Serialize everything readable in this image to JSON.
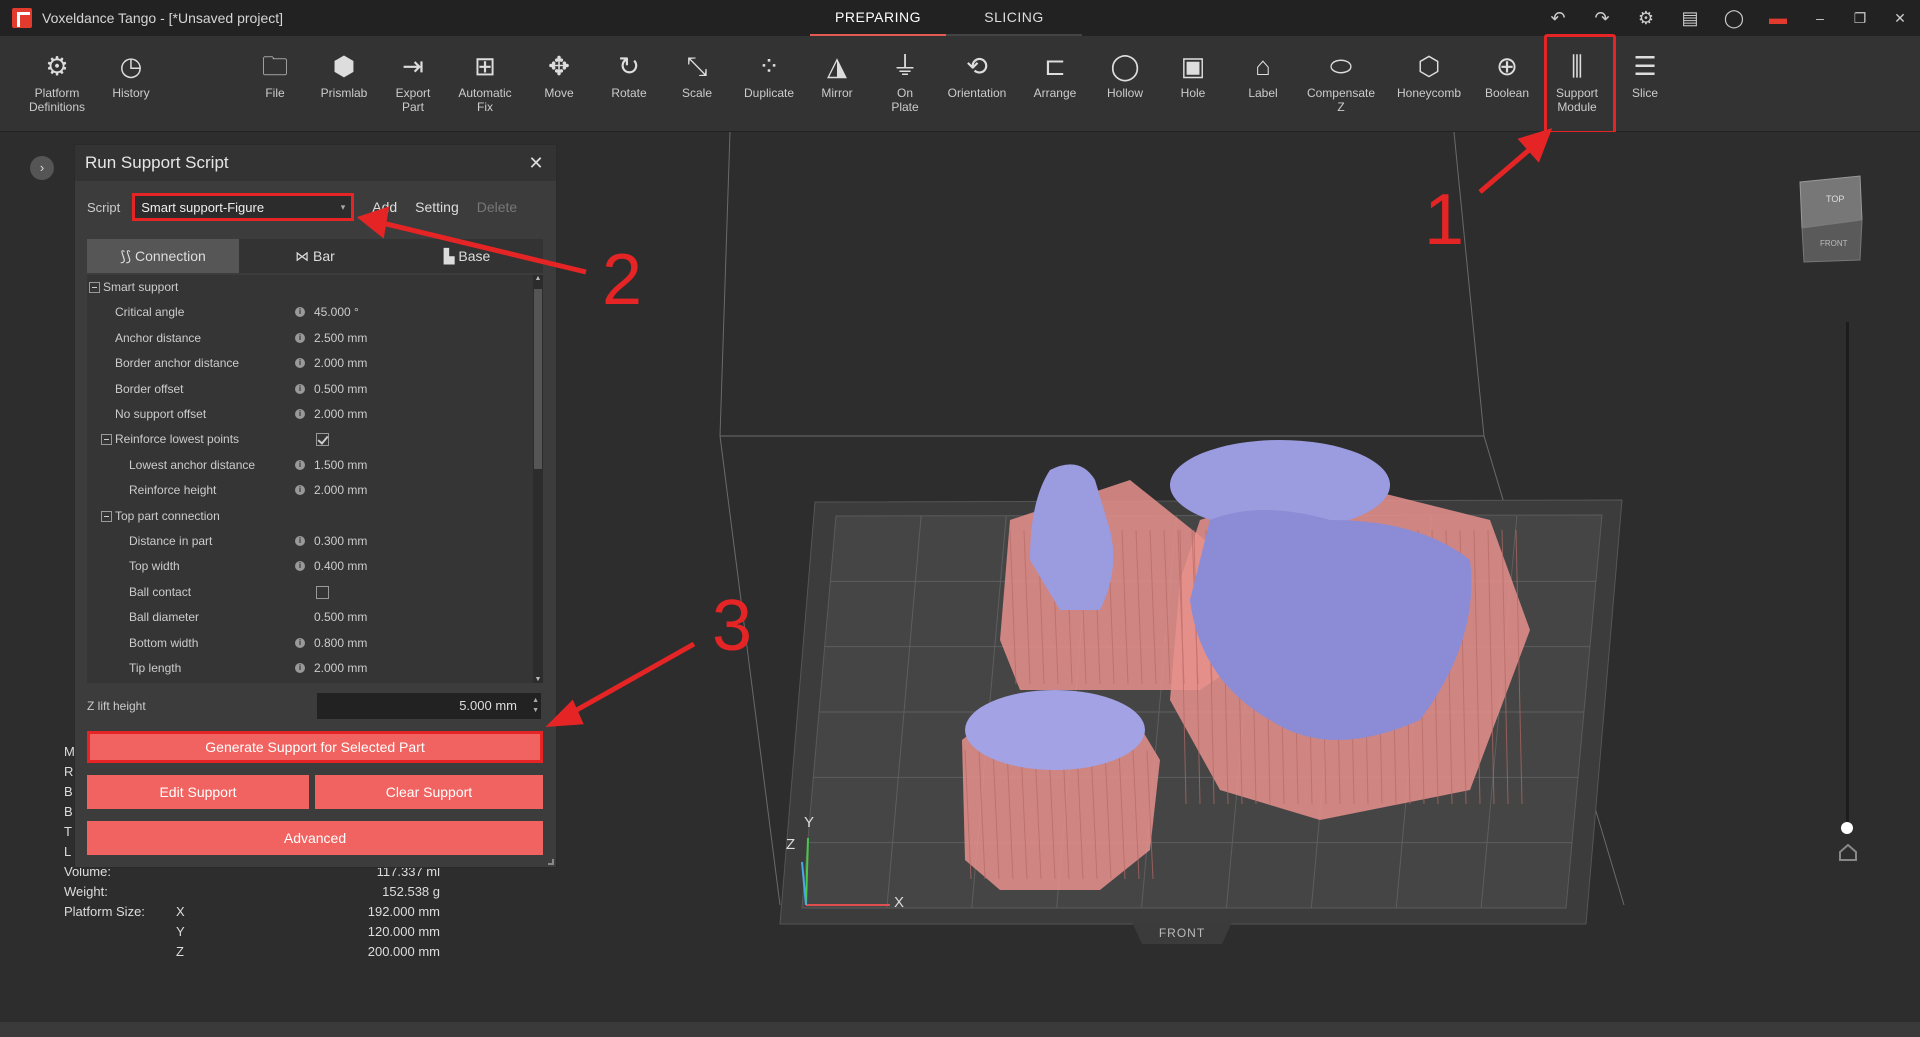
{
  "app": {
    "title": "Voxeldance Tango - [*Unsaved project]"
  },
  "mode_tabs": [
    {
      "label": "PREPARING",
      "active": true
    },
    {
      "label": "SLICING",
      "active": false
    }
  ],
  "title_icons": [
    "undo-icon",
    "redo-icon",
    "settings-icon",
    "feedback-icon",
    "account-icon",
    "license-icon",
    "minimize-icon",
    "restore-icon",
    "close-icon"
  ],
  "toolbar": {
    "tools": [
      {
        "label": "Platform\nDefinitions",
        "icon": "platform-definitions-icon"
      },
      {
        "label": "History",
        "icon": "history-icon"
      },
      {
        "label": "File",
        "icon": "file-icon"
      },
      {
        "label": "Prismlab",
        "icon": "prismlab-icon"
      },
      {
        "label": "Export\nPart",
        "icon": "export-part-icon"
      },
      {
        "label": "Automatic\nFix",
        "icon": "automatic-fix-icon"
      },
      {
        "label": "Move",
        "icon": "move-icon"
      },
      {
        "label": "Rotate",
        "icon": "rotate-icon"
      },
      {
        "label": "Scale",
        "icon": "scale-icon"
      },
      {
        "label": "Duplicate",
        "icon": "duplicate-icon"
      },
      {
        "label": "Mirror",
        "icon": "mirror-icon"
      },
      {
        "label": "On\nPlate",
        "icon": "on-plate-icon"
      },
      {
        "label": "Orientation",
        "icon": "orientation-icon"
      },
      {
        "label": "Arrange",
        "icon": "arrange-icon"
      },
      {
        "label": "Hollow",
        "icon": "hollow-icon"
      },
      {
        "label": "Hole",
        "icon": "hole-icon"
      },
      {
        "label": "Label",
        "icon": "label-icon"
      },
      {
        "label": "Compensate\nZ",
        "icon": "compensate-z-icon"
      },
      {
        "label": "Honeycomb",
        "icon": "honeycomb-icon"
      },
      {
        "label": "Boolean",
        "icon": "boolean-icon"
      },
      {
        "label": "Support\nModule",
        "icon": "support-module-icon"
      },
      {
        "label": "Slice",
        "icon": "slice-icon"
      }
    ]
  },
  "dialog": {
    "title": "Run Support Script",
    "script_label": "Script",
    "script_value": "Smart support-Figure",
    "add_label": "Add",
    "setting_label": "Setting",
    "delete_label": "Delete",
    "subtabs": [
      {
        "label": "Connection",
        "icon": "connection-icon",
        "active": true
      },
      {
        "label": "Bar",
        "icon": "bar-icon",
        "active": false
      },
      {
        "label": "Base",
        "icon": "base-icon",
        "active": false
      }
    ],
    "params": [
      {
        "name": "Smart support",
        "type": "group",
        "level": 0
      },
      {
        "name": "Critical angle",
        "value": "45.000 °",
        "level": 1
      },
      {
        "name": "Anchor distance",
        "value": "2.500 mm",
        "level": 1
      },
      {
        "name": "Border anchor distance",
        "value": "2.000 mm",
        "level": 1
      },
      {
        "name": "Border offset",
        "value": "0.500 mm",
        "level": 1
      },
      {
        "name": "No support offset",
        "value": "2.000 mm",
        "level": 1
      },
      {
        "name": "Reinforce lowest points",
        "type": "group-check",
        "checked": true,
        "level": 1
      },
      {
        "name": "Lowest anchor distance",
        "value": "1.500 mm",
        "level": 2
      },
      {
        "name": "Reinforce height",
        "value": "2.000 mm",
        "level": 2
      },
      {
        "name": "Top part connection",
        "type": "group",
        "level": 1
      },
      {
        "name": "Distance in part",
        "value": "0.300 mm",
        "level": 2
      },
      {
        "name": "Top width",
        "value": "0.400 mm",
        "level": 2
      },
      {
        "name": "Ball contact",
        "type": "check",
        "checked": false,
        "level": 2
      },
      {
        "name": "Ball diameter",
        "value": "0.500 mm",
        "level": 2,
        "noinfo": true
      },
      {
        "name": "Bottom width",
        "value": "0.800 mm",
        "level": 2
      },
      {
        "name": "Tip length",
        "value": "2.000 mm",
        "level": 2
      }
    ],
    "zlift_label": "Z lift height",
    "zlift_value": "5.000 mm",
    "generate_label": "Generate Support for Selected Part",
    "edit_label": "Edit Support",
    "clear_label": "Clear Support",
    "advanced_label": "Advanced"
  },
  "info": {
    "partial_letters": [
      "M",
      "R",
      "B",
      "B",
      "T",
      "L"
    ],
    "volume_label": "Volume:",
    "volume_value": "117.337 ml",
    "weight_label": "Weight:",
    "weight_value": "152.538 g",
    "platform_label": "Platform Size:",
    "platform": [
      {
        "axis": "X",
        "value": "192.000 mm"
      },
      {
        "axis": "Y",
        "value": "120.000 mm"
      },
      {
        "axis": "Z",
        "value": "200.000 mm"
      }
    ]
  },
  "annotations": [
    "1",
    "2",
    "3"
  ],
  "viewport": {
    "front_label": "FRONT",
    "axis_x": "X",
    "axis_y": "Y",
    "axis_z": "Z",
    "navcube_top": "TOP",
    "navcube_front": "FRONT"
  },
  "colors": {
    "accent": "#f06360",
    "highlight": "#e52525",
    "model": "#9b9be0",
    "support": "#e8908c"
  }
}
